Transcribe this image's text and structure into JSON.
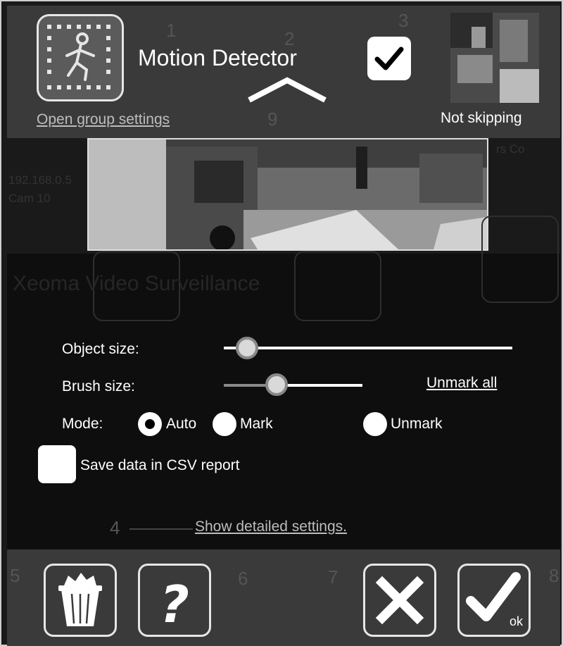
{
  "header": {
    "title": "Motion Detector",
    "open_group_settings": "Open group settings",
    "skip_status": "Not skipping",
    "enabled": true
  },
  "background": {
    "numbers": [
      "1",
      "2",
      "3",
      "9",
      "4",
      "5",
      "6",
      "7",
      "8"
    ],
    "ip_text": "192.168.0.5",
    "cam_text": "Cam 10",
    "brand_text": "Xeoma Video Surveillance",
    "corner_text": "rs Co"
  },
  "settings": {
    "object_size_label": "Object size:",
    "object_size_value": 0.08,
    "brush_size_label": "Brush size:",
    "brush_size_value": 0.38,
    "unmark_all": "Unmark all",
    "mode_label": "Mode:",
    "modes": [
      {
        "label": "Auto",
        "selected": true
      },
      {
        "label": "Mark",
        "selected": false
      },
      {
        "label": "Unmark",
        "selected": false
      }
    ],
    "csv_label": "Save data in CSV report",
    "csv_checked": false,
    "show_detailed": "Show detailed settings."
  },
  "footer": {
    "ok_label": "ok",
    "icons": [
      "trash-icon",
      "help-icon",
      "close-icon",
      "ok-check-icon"
    ]
  },
  "colors": {
    "panel": "#3a3a3a",
    "dark": "#0e0e0e",
    "white": "#ffffff"
  }
}
